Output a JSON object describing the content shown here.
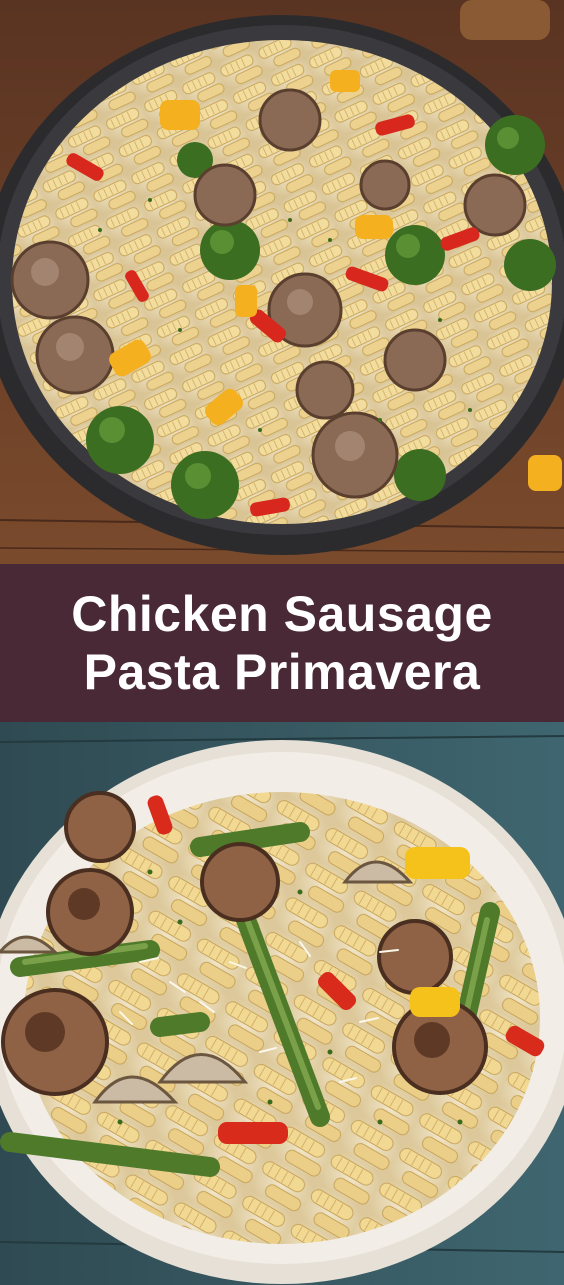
{
  "title": {
    "line1": "Chicken Sausage",
    "line2": "Pasta Primavera"
  },
  "colors": {
    "banner_background": "#4a2936",
    "title_text": "#ffffff"
  }
}
